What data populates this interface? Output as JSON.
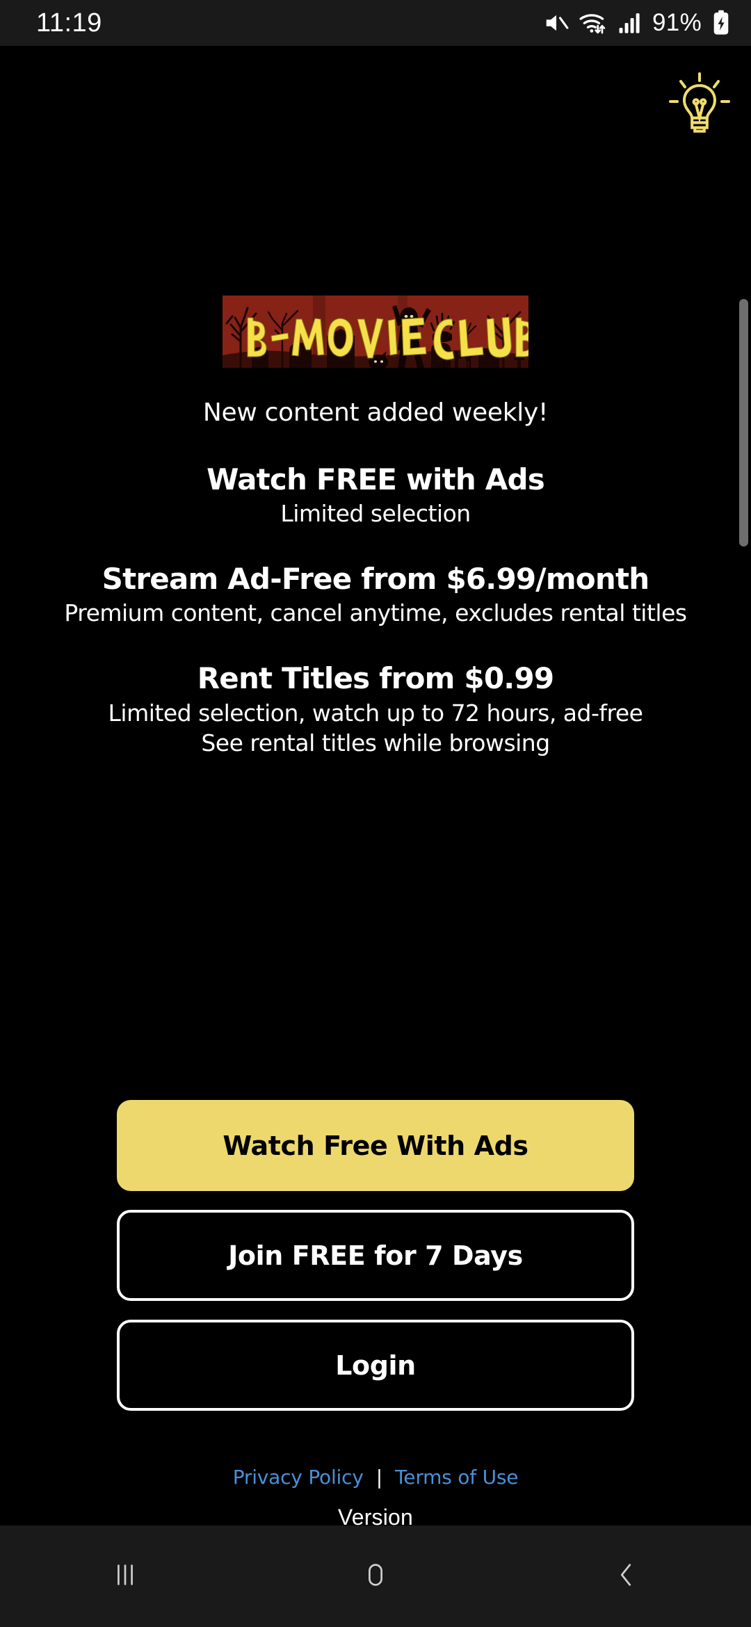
{
  "status_bar": {
    "clock": "11:19",
    "battery_percent": "91%",
    "icons": [
      "mute-icon",
      "wifi-icon",
      "signal-icon",
      "battery-charging-icon"
    ]
  },
  "app": {
    "help_icon": "lightbulb-icon",
    "logo": {
      "name": "b-movie-club-logo",
      "text": "B-MOVIE CLUB",
      "background_color": "#8B2418",
      "text_color": "#F5E04A"
    },
    "tagline": "New content added weekly!",
    "plans": [
      {
        "title": "Watch FREE with Ads",
        "subtitle": "Limited selection"
      },
      {
        "title": "Stream Ad-Free from $6.99/month",
        "subtitle": "Premium content, cancel anytime, excludes rental titles"
      },
      {
        "title": "Rent Titles from $0.99",
        "subtitle_line1": "Limited selection, watch up to 72 hours, ad-free",
        "subtitle_line2": "See rental titles while browsing"
      }
    ],
    "buttons": {
      "watch_free": "Watch Free With Ads",
      "join_free": "Join FREE for 7 Days",
      "login": "Login"
    },
    "footer": {
      "privacy_policy": "Privacy Policy",
      "separator": "|",
      "terms_of_use": "Terms of Use",
      "version": "Version"
    }
  },
  "nav_bar": {
    "recents": "recents-icon",
    "home": "home-icon",
    "back": "back-icon"
  },
  "colors": {
    "accent_yellow": "#EDD86E",
    "link_blue": "#4a90d9",
    "background": "#000000",
    "chrome": "#1a1a1a"
  }
}
